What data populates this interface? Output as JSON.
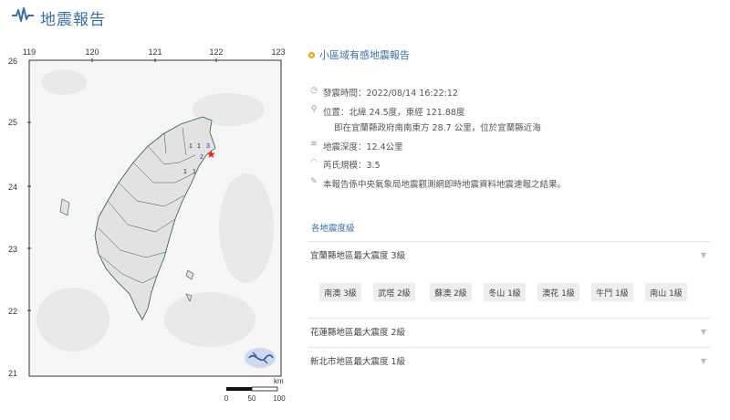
{
  "header": {
    "title": "地震報告",
    "logo_icon": "seismic-wave-icon"
  },
  "map": {
    "lon_ticks": [
      "119",
      "120",
      "121",
      "122",
      "123"
    ],
    "lat_ticks": [
      "26",
      "25",
      "24",
      "23",
      "22",
      "21"
    ],
    "station_labels": [
      "1",
      "1",
      "3",
      "2",
      "1",
      "1"
    ],
    "scale": {
      "unit": "km",
      "labels": [
        "0",
        "50",
        "100"
      ]
    },
    "epicenter_color": "#e8201a"
  },
  "report": {
    "subtitle": "小區域有感地震報告",
    "time": "發震時間：2022/08/14 16:22:12",
    "location_line1": "位置：北緯 24.5度，東經 121.88度",
    "location_line2": "即在宜蘭縣政府南南東方 28.7 公里，位於宜蘭縣近海",
    "depth": "地震深度：12.4公里",
    "magnitude": "芮氏規模：3.5",
    "note": "本報告係中央氣象局地震觀測網即時地震資料地震速報之結果。"
  },
  "intensity": {
    "section_title": "各地震度級",
    "regions": [
      {
        "label": "宜蘭縣地區最大震度 3級"
      },
      {
        "label": "花蓮縣地區最大震度 2級"
      },
      {
        "label": "新北市地區最大震度 1級"
      }
    ],
    "yilan_stations": [
      "南澳 3級",
      "武塔 2級",
      "蘇澳 2級",
      "冬山 1級",
      "澳花 1級",
      "牛鬥 1級",
      "南山 1級"
    ]
  }
}
